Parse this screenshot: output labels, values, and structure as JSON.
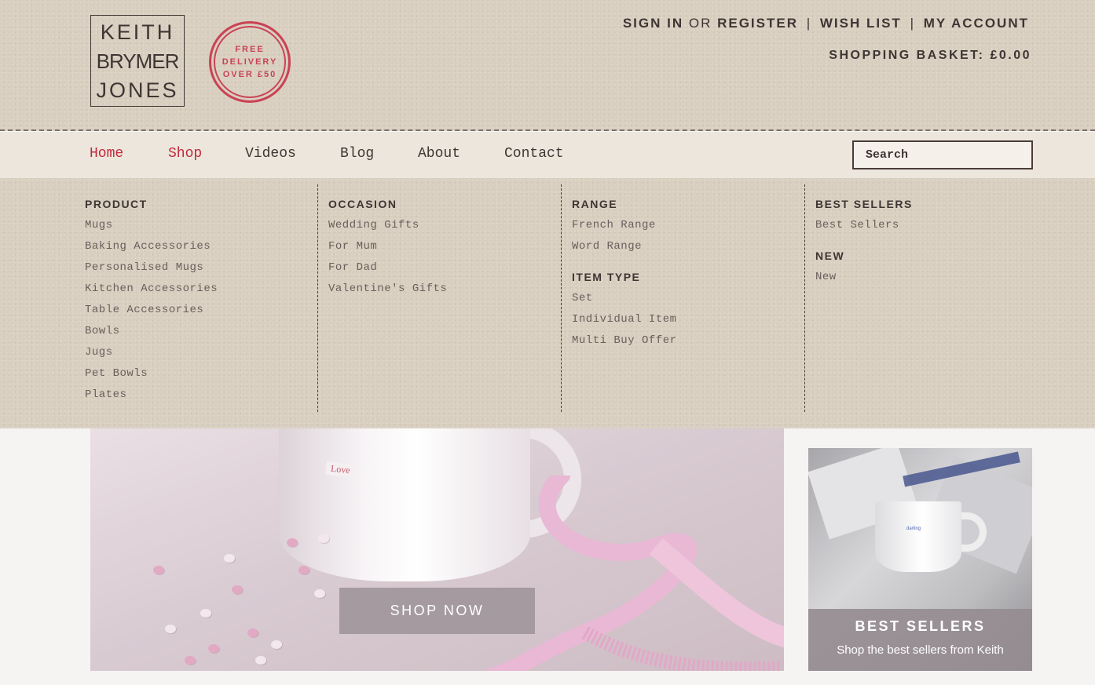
{
  "header": {
    "logo_lines": [
      "KEITH",
      "BRYMER",
      "JONES"
    ],
    "stamp_lines": [
      "FREE",
      "DELIVERY",
      "OVER £50"
    ],
    "account": {
      "sign_in": "SIGN IN",
      "or": "OR",
      "register": "REGISTER",
      "separator": "|",
      "wish_list": "WISH LIST",
      "my_account": "MY ACCOUNT"
    },
    "basket": "SHOPPING BASKET: £0.00"
  },
  "nav": {
    "items": [
      {
        "label": "Home",
        "active": true
      },
      {
        "label": "Shop",
        "active": true
      },
      {
        "label": "Videos",
        "active": false
      },
      {
        "label": "Blog",
        "active": false
      },
      {
        "label": "About",
        "active": false
      },
      {
        "label": "Contact",
        "active": false
      }
    ],
    "search_placeholder": "Search"
  },
  "mega_menu": {
    "product": {
      "heading": "PRODUCT",
      "links": [
        "Mugs",
        "Baking Accessories",
        "Personalised Mugs",
        "Kitchen Accessories",
        "Table Accessories",
        "Bowls",
        "Jugs",
        "Pet Bowls",
        "Plates"
      ]
    },
    "occasion": {
      "heading": "OCCASION",
      "links": [
        "Wedding Gifts",
        "For Mum",
        "For Dad",
        "Valentine's Gifts"
      ]
    },
    "range": {
      "heading": "RANGE",
      "links": [
        "French Range",
        "Word Range"
      ]
    },
    "item_type": {
      "heading": "ITEM TYPE",
      "links": [
        "Set",
        "Individual Item",
        "Multi Buy Offer"
      ]
    },
    "best_sellers": {
      "heading": "BEST SELLERS",
      "links": [
        "Best Sellers"
      ]
    },
    "new": {
      "heading": "NEW",
      "links": [
        "New"
      ]
    }
  },
  "hero": {
    "mug_word": "Love",
    "button": "SHOP NOW"
  },
  "promo": {
    "mug_word": "darling",
    "title": "BEST SELLERS",
    "subtitle": "Shop the best sellers from Keith"
  },
  "colors": {
    "kraft": "#d9cfc0",
    "nav_bg": "#ede6dc",
    "text_dark": "#3f3533",
    "accent_red": "#c22a3d",
    "stamp_red": "#c8344a",
    "button_grey": "#a49a9f"
  }
}
